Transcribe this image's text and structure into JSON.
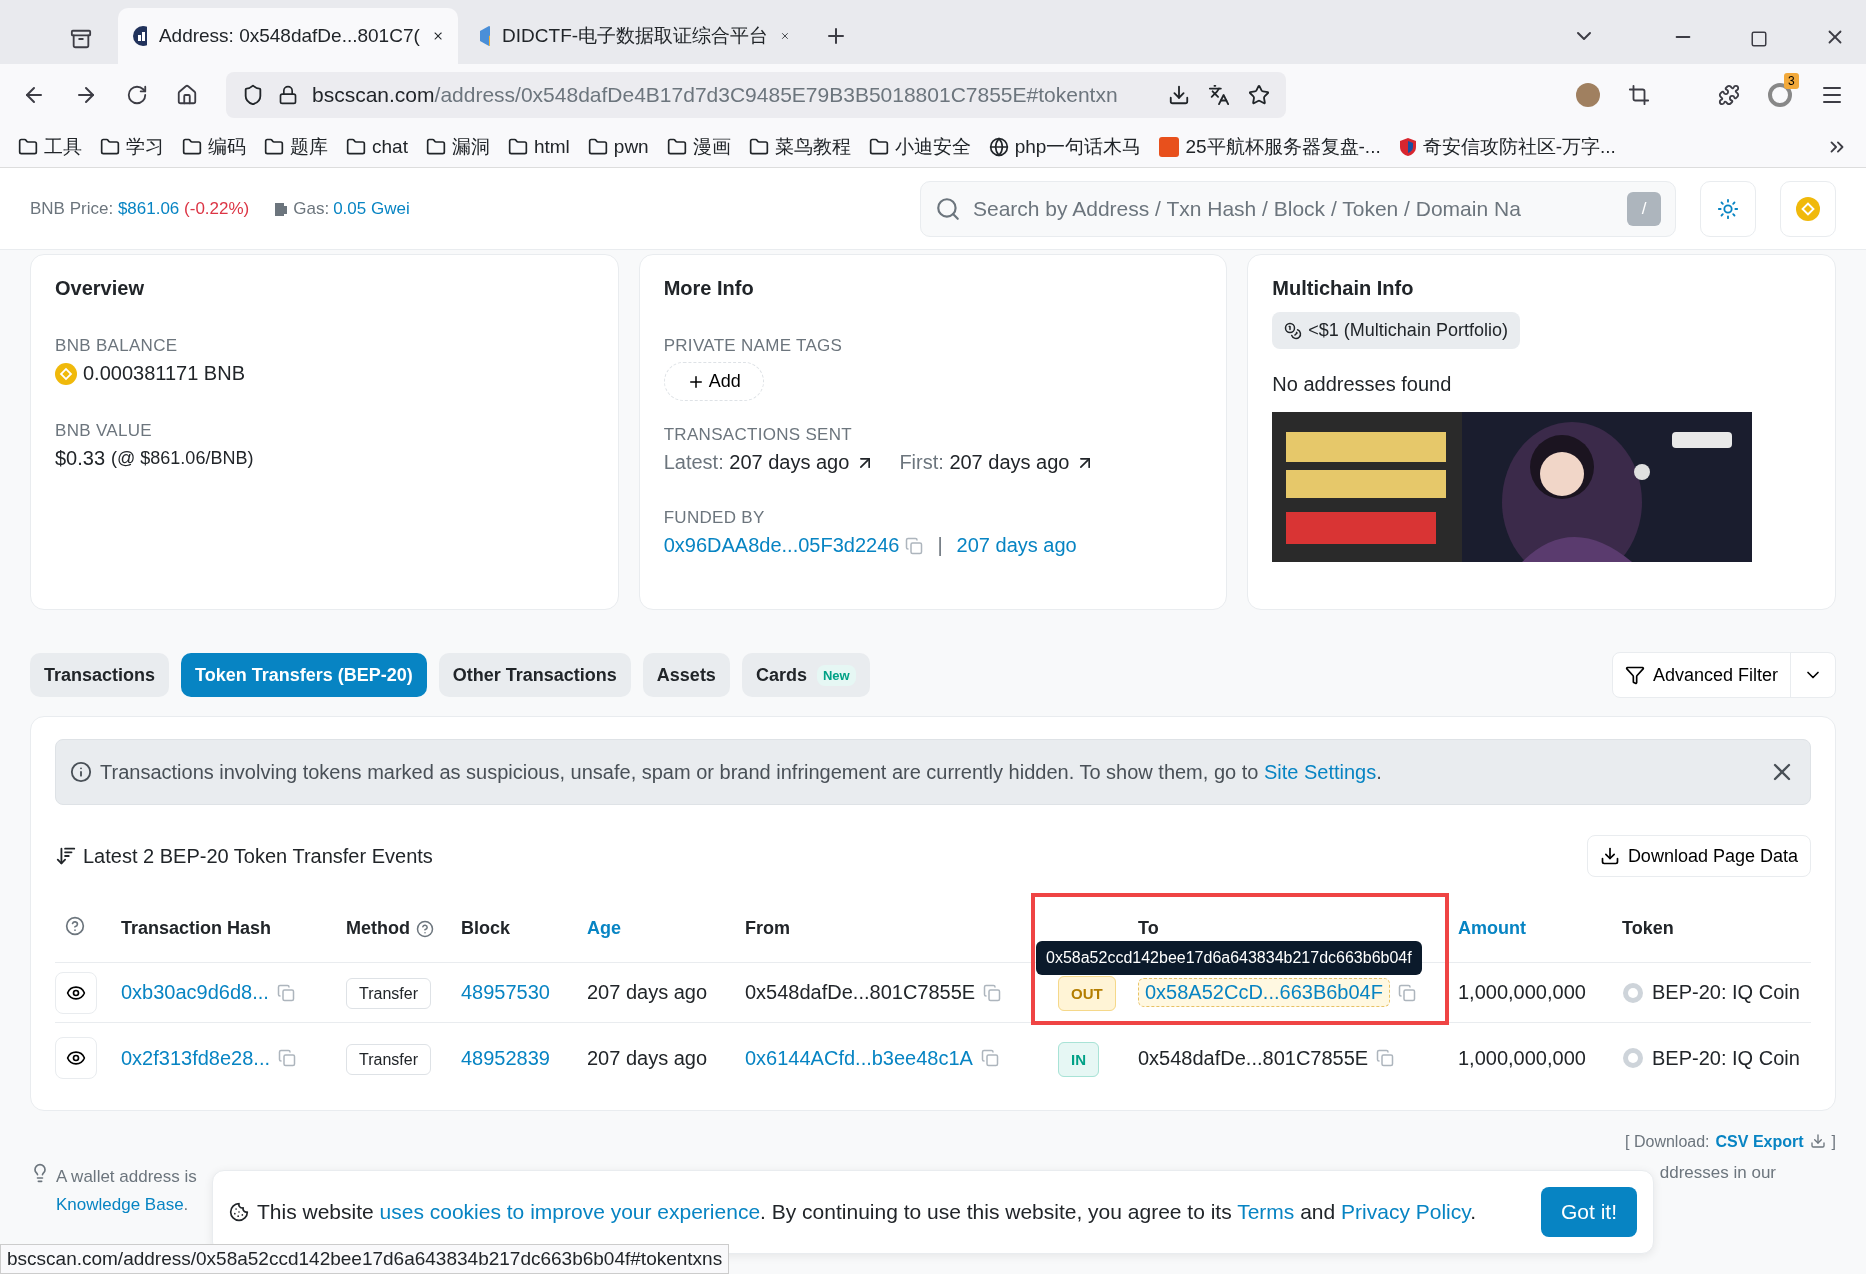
{
  "browser": {
    "tabs": [
      {
        "title": "Address: 0x548dafDe...801C7(",
        "selected": true
      },
      {
        "title": "DIDCTF-电子数据取证综合平台",
        "selected": false
      }
    ],
    "address": {
      "host": "bscscan.com",
      "path": "/address/0x548dafDe4B17d7d3C9485E79B3B5018801C7855E#tokentxn"
    },
    "extension_badge": "3",
    "bookmarks": [
      {
        "label": "工具",
        "kind": "folder"
      },
      {
        "label": "学习",
        "kind": "folder"
      },
      {
        "label": "编码",
        "kind": "folder"
      },
      {
        "label": "题库",
        "kind": "folder"
      },
      {
        "label": "chat",
        "kind": "folder"
      },
      {
        "label": "漏洞",
        "kind": "folder"
      },
      {
        "label": "html",
        "kind": "folder"
      },
      {
        "label": "pwn",
        "kind": "folder"
      },
      {
        "label": "漫画",
        "kind": "folder"
      },
      {
        "label": "菜鸟教程",
        "kind": "folder"
      },
      {
        "label": "小迪安全",
        "kind": "folder"
      },
      {
        "label": "php一句话木马",
        "kind": "globe"
      },
      {
        "label": "25平航杯服务器复盘-...",
        "kind": "letter"
      },
      {
        "label": "奇安信攻防社区-万字...",
        "kind": "shield"
      }
    ]
  },
  "header": {
    "price_label": "BNB Price:",
    "price": "$861.06",
    "change": "(-0.22%)",
    "gas_label": "Gas:",
    "gas": "0.05 Gwei",
    "search": {
      "placeholder": "Search by Address / Txn Hash / Block / Token / Domain Na"
    },
    "search_key": "/"
  },
  "overview": {
    "title": "Overview",
    "balance_label": "BNB BALANCE",
    "balance": "0.000381171 BNB",
    "value_label": "BNB VALUE",
    "value": "$0.33",
    "value_note": "(@ $861.06/BNB)"
  },
  "more_info": {
    "title": "More Info",
    "tags_label": "PRIVATE NAME TAGS",
    "add_button": "Add",
    "sent_label": "TRANSACTIONS SENT",
    "latest_label": "Latest:",
    "latest": "207 days ago",
    "first_label": "First:",
    "first": "207 days ago",
    "funded_label": "FUNDED BY",
    "funded_by": "0x96DAA8de...05F3d2246",
    "separator": "|",
    "funded_age": "207 days ago"
  },
  "multichain": {
    "title": "Multichain Info",
    "portfolio": "<$1 (Multichain Portfolio)",
    "empty": "No addresses found"
  },
  "tabs": [
    {
      "label": "Transactions",
      "selected": false
    },
    {
      "label": "Token Transfers (BEP-20)",
      "selected": true
    },
    {
      "label": "Other Transactions",
      "selected": false
    },
    {
      "label": "Assets",
      "selected": false
    },
    {
      "label": "Cards",
      "selected": false,
      "badge": "New"
    }
  ],
  "advanced_filter": "Advanced Filter",
  "notice": {
    "text": "Transactions involving tokens marked as suspicious, unsafe, spam or brand infringement are currently hidden. To show them, go to ",
    "link": "Site Settings",
    "end": "."
  },
  "events_title": "Latest 2 BEP-20 Token Transfer Events",
  "download_button": "Download Page Data",
  "table": {
    "columns": [
      {
        "kind": "help"
      },
      {
        "label": "Transaction Hash",
        "kind": "plain"
      },
      {
        "label": "Method",
        "kind": "plain",
        "help": true
      },
      {
        "label": "Block",
        "kind": "plain"
      },
      {
        "label": "Age",
        "kind": "link"
      },
      {
        "label": "From",
        "kind": "plain"
      },
      {
        "kind": "plain"
      },
      {
        "label": "To",
        "kind": "plain"
      },
      {
        "label": "Amount",
        "kind": "link"
      },
      {
        "label": "Token",
        "kind": "plain"
      }
    ],
    "rows": [
      {
        "hash": "0xb30ac9d6d8...",
        "method": "Transfer",
        "block": "48957530",
        "age": "207 days ago",
        "from": "0x548dafDe...801C7855E",
        "from_link": false,
        "direction": "OUT",
        "to": "0x58A52CcD...663B6b04F",
        "to_link": true,
        "to_highlighted": true,
        "amount": "1,000,000,000",
        "token": "BEP-20: IQ Coin"
      },
      {
        "hash": "0x2f313fd8e28...",
        "method": "Transfer",
        "block": "48952839",
        "age": "207 days ago",
        "from": "0x6144ACfd...b3ee48c1A",
        "from_link": true,
        "direction": "IN",
        "to": "0x548dafDe...801C7855E",
        "to_link": false,
        "to_highlighted": false,
        "amount": "1,000,000,000",
        "token": "BEP-20: IQ Coin"
      }
    ]
  },
  "tooltip": "0x58a52ccd142bee17d6a643834b217dc663b6b04f",
  "csv": {
    "prefix": "[ Download:",
    "link": "CSV Export",
    "suffix": "]"
  },
  "tip": {
    "start": "A wallet address is",
    "link": "Knowledge Base",
    "end": ".",
    "tail": "ddresses in our"
  },
  "cookie": {
    "parts": [
      {
        "text": "This website ",
        "kind": "plain"
      },
      {
        "text": "uses cookies to improve your experience",
        "kind": "link"
      },
      {
        "text": ". By continuing to use this website, you agree to its ",
        "kind": "plain"
      },
      {
        "text": "Terms",
        "kind": "link"
      },
      {
        "text": " and ",
        "kind": "plain"
      },
      {
        "text": "Privacy Policy",
        "kind": "link"
      },
      {
        "text": ".",
        "kind": "plain"
      }
    ],
    "button": "Got it!"
  },
  "status_bar": "bscscan.com/address/0x58a52ccd142bee17d6a643834b217dc663b6b04f#tokentxns"
}
